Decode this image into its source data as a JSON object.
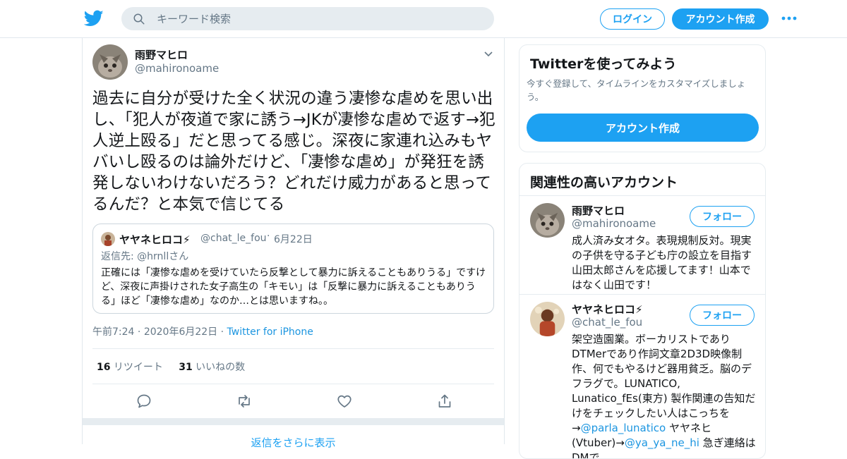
{
  "header": {
    "logo_icon": "twitter-bird-icon",
    "search_placeholder": "キーワード検索",
    "login_label": "ログイン",
    "signup_label": "アカウント作成",
    "more_icon": "more-dots-icon",
    "accent_color": "#1da1f2"
  },
  "tweet": {
    "author_name": "雨野マヒロ",
    "author_handle": "@mahironoame",
    "text": "過去に自分が受けた全く状況の違う凄惨な虐めを思い出し、「犯人が夜道で家に誘う→JKが凄惨な虐めで返す→犯人逆上殴る」だと思ってる感じ。深夜に家連れ込みもヤバいし殴るのは論外だけど、「凄惨な虐め」が発狂を誘発しないわけないだろう？どれだけ威力があると思ってるんだ？と本気で信じてる",
    "quote": {
      "name": "ヤヤネヒロコ⚡",
      "handle": "@chat_le_fou",
      "dot": "·",
      "date": "6月22日",
      "reply_prefix": "返信先: ",
      "reply_user": "@hrnllさん",
      "text": "正確には「凄惨な虐めを受けていたら反撃として暴力に訴えることもありうる」ですけど、深夜に声掛けされた女子高生の「キモい」は「反撃に暴力に訴えることもありうる」ほど「凄惨な虐め」なのか…とは思いますね。。"
    },
    "time": "午前7:24",
    "sep1": " · ",
    "date": "2020年6月22日",
    "sep2": " · ",
    "source": "Twitter for iPhone",
    "retweet_count": "16",
    "retweet_label": " リツイート",
    "like_count": "31",
    "like_label": " いいねの数",
    "actions": [
      "reply-icon",
      "retweet-icon",
      "like-icon",
      "share-icon"
    ],
    "more_replies": "返信をさらに表示"
  },
  "sidebar": {
    "promo": {
      "title": "Twitterを使ってみよう",
      "subtitle": "今すぐ登録して、タイムラインをカスタマイズしましょう。",
      "button": "アカウント作成"
    },
    "related": {
      "title": "関連性の高いアカウント",
      "accounts": [
        {
          "name": "雨野マヒロ",
          "handle": "@mahironoame",
          "follow": "フォロー",
          "bio": "成人済み女オタ。表現規制反対。現実の子供を守る子ども庁の設立を目指す山田太郎さんを応援してます！山本ではなく山田です！"
        },
        {
          "name": "ヤヤネヒロコ⚡",
          "handle": "@chat_le_fou",
          "follow": "フォロー",
          "bio_1": "架空造園業。ボーカリストでありDTMerであり作詞文章2D3D映像制作、何でもやるけど器用貧乏。脳のデフラグで。LUNATICO, Lunatico_fEs(東方) 製作関連の告知だけをチェックしたい人はこっちを→",
          "bio_link1": "@parla_lunatico",
          "bio_2": " ヤヤネヒ(Vtuber)→",
          "bio_link2": "@ya_ya_ne_hi",
          "bio_3": " 急ぎ連絡はDMで"
        }
      ]
    }
  }
}
